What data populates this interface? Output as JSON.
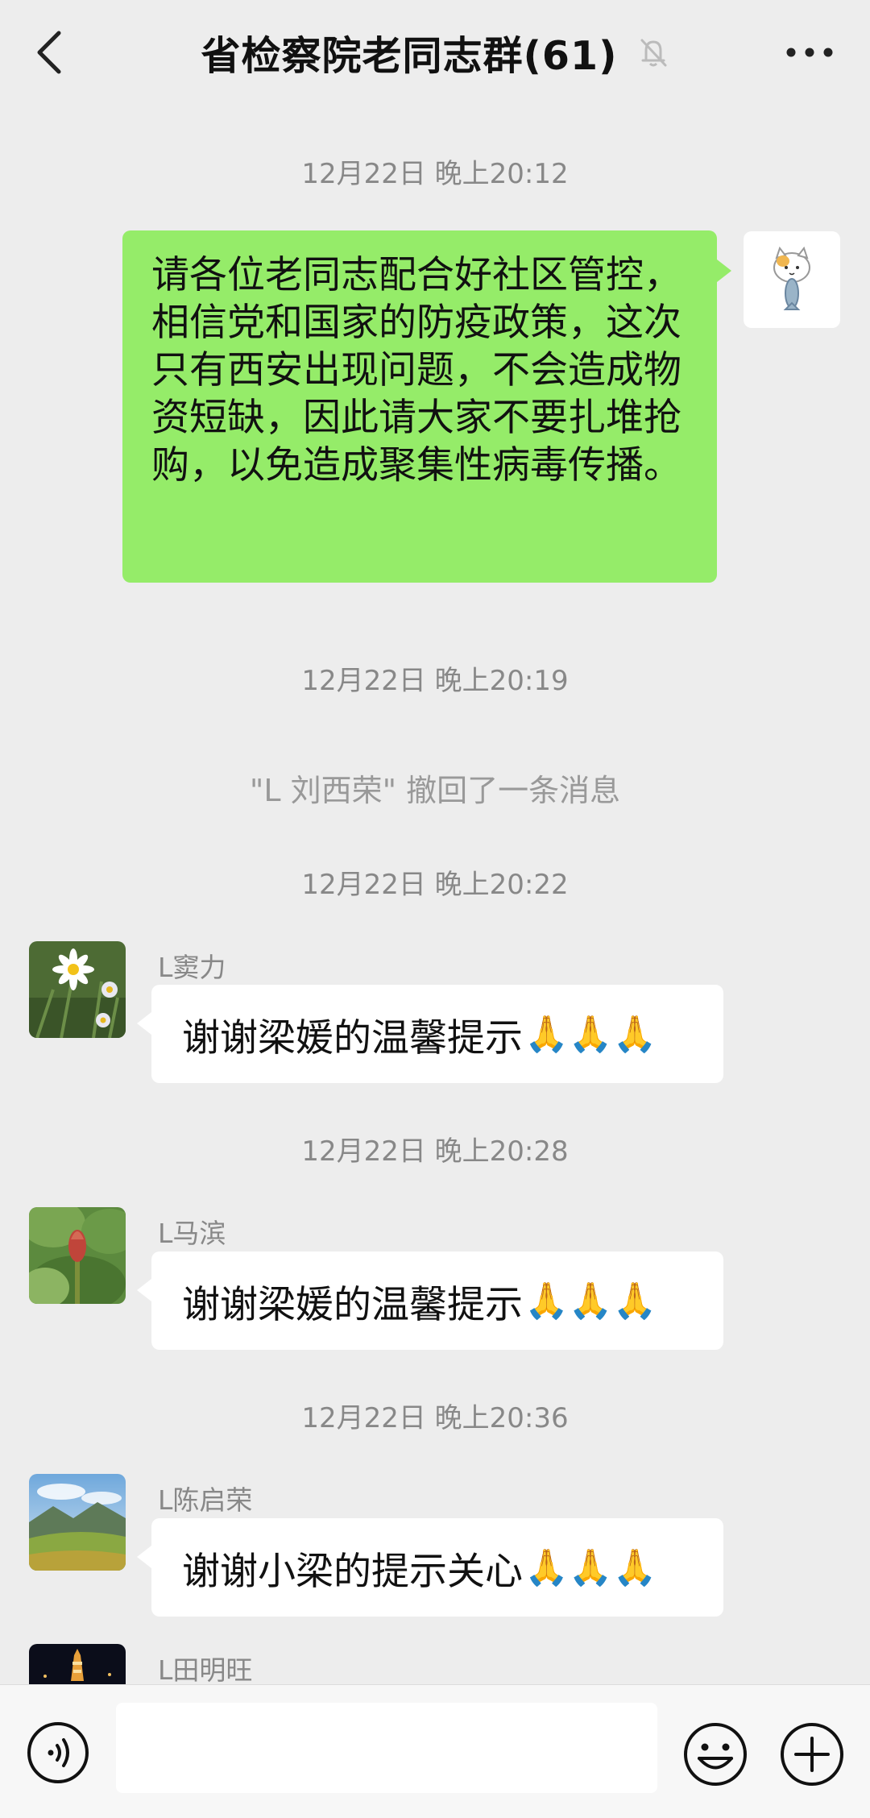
{
  "header": {
    "title": "省检察院老同志群(61)",
    "back_icon": "chevron-left-icon",
    "mute_icon": "bell-off-icon",
    "more_icon": "more-dots-icon"
  },
  "messages": {
    "ts1": "12月22日 晚上20:12",
    "self_text": "请各位老同志配合好社区管控，相信党和国家的防疫政策，这次只有西安出现问题，不会造成物资短缺，因此请大家不要扎堆抢购，以免造成聚集性病毒传播。",
    "ts2": "12月22日 晚上20:19",
    "recall_notice": "\"L 刘西荣\" 撤回了一条消息",
    "ts3": "12月22日 晚上20:22",
    "msg1_sender": "L窦力",
    "msg1_text": "谢谢梁媛的温馨提示",
    "ts4": "12月22日 晚上20:28",
    "msg2_sender": "L马滨",
    "msg2_text": "谢谢梁媛的温馨提示",
    "ts5": "12月22日 晚上20:36",
    "msg3_sender": "L陈启荣",
    "msg3_text": "谢谢小梁的提示关心",
    "msg4_sender": "L田明旺",
    "pray_emoji": "🙏🙏🙏"
  },
  "input_bar": {
    "voice_icon": "voice-icon",
    "emoji_icon": "smiley-icon",
    "plus_icon": "plus-circle-icon",
    "input_value": ""
  },
  "colors": {
    "background": "#ededed",
    "self_bubble": "#95ec69",
    "other_bubble": "#ffffff",
    "timestamp": "#888888"
  }
}
